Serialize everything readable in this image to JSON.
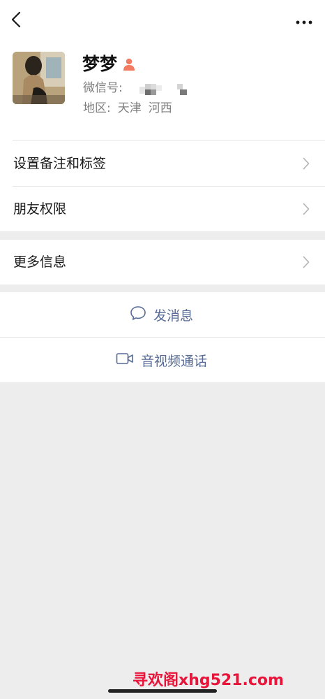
{
  "profile": {
    "name": "梦梦",
    "wxid_label": "微信号:",
    "region_label": "地区:",
    "region_province": "天津",
    "region_city": "河西"
  },
  "menu": {
    "items": [
      {
        "label": "设置备注和标签"
      },
      {
        "label": "朋友权限"
      },
      {
        "label": "更多信息"
      }
    ]
  },
  "actions": {
    "message_label": "发消息",
    "call_label": "音视频通话"
  },
  "watermark": "寻欢阁xhg521.com",
  "colors": {
    "link_blue": "#576b95",
    "background": "#ededed",
    "gender_icon": "#f37b61",
    "watermark_red": "#e8143a"
  },
  "icons": [
    "back-arrow-icon",
    "more-icon",
    "gender-female-icon",
    "chevron-right-icon",
    "chat-bubble-icon",
    "video-camera-icon"
  ]
}
